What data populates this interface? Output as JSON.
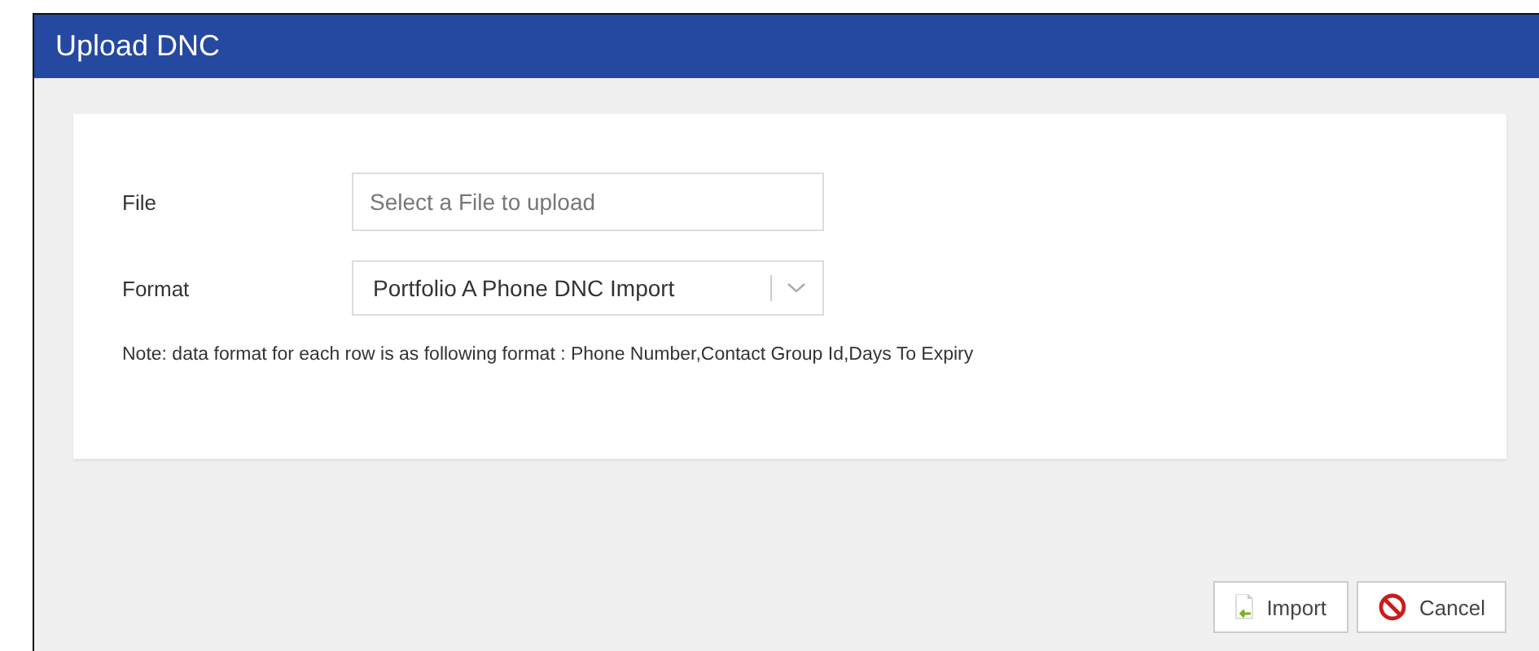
{
  "window": {
    "title": "Upload DNC"
  },
  "form": {
    "fields": [
      {
        "kind": "text",
        "label": "File",
        "placeholder": "Select a File to upload"
      },
      {
        "kind": "select",
        "label": "Format",
        "value": "Portfolio A Phone DNC Import"
      }
    ],
    "note": "Note: data format for each row is as following format : Phone Number,Contact Group Id,Days To Expiry"
  },
  "buttons": [
    {
      "kind": "import",
      "label": "Import"
    },
    {
      "kind": "cancel",
      "label": "Cancel"
    }
  ]
}
